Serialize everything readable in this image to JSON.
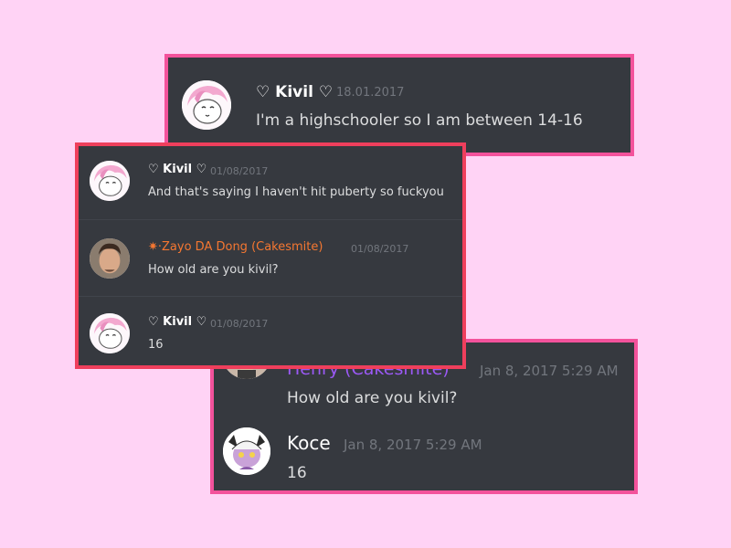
{
  "screenshot_top": {
    "message": {
      "author": "♡ Kivil ♡",
      "timestamp": "18.01.2017",
      "text": "I'm a highschooler so I am between 14-16"
    }
  },
  "screenshot_middle": {
    "messages": [
      {
        "author": "♡ Kivil ♡",
        "timestamp": "01/08/2017",
        "text": "And that's saying I haven't hit puberty so fuckyou"
      },
      {
        "author": "✷·Zayo DA Dong (Cakesmite)",
        "timestamp": "01/08/2017",
        "text": "How old are you kivil?",
        "author_color": "#f57731"
      },
      {
        "author": "♡ Kivil ♡",
        "timestamp": "01/08/2017",
        "text": "16"
      }
    ]
  },
  "screenshot_bottom": {
    "messages": [
      {
        "author": "Henry (Cakesmite)",
        "timestamp": "Jan 8, 2017 5:29 AM",
        "text": "How old are you kivil?",
        "author_color": "#9b59f6"
      },
      {
        "author": "Koce",
        "timestamp": "Jan 8, 2017 5:29 AM",
        "text": "16"
      }
    ]
  },
  "colors": {
    "background": "#ffd3f5",
    "panel": "#36393f",
    "border_pink": "#f3529b",
    "border_red": "#ef3f5c",
    "timestamp": "#72767d",
    "text": "#dcddde"
  },
  "icons": {
    "kivil_avatar": "pink-haired-character-avatar-icon",
    "zayo_avatar": "man-photo-avatar-icon",
    "henry_avatar": "man-photo-avatar-icon",
    "koce_avatar": "horned-character-avatar-icon"
  }
}
